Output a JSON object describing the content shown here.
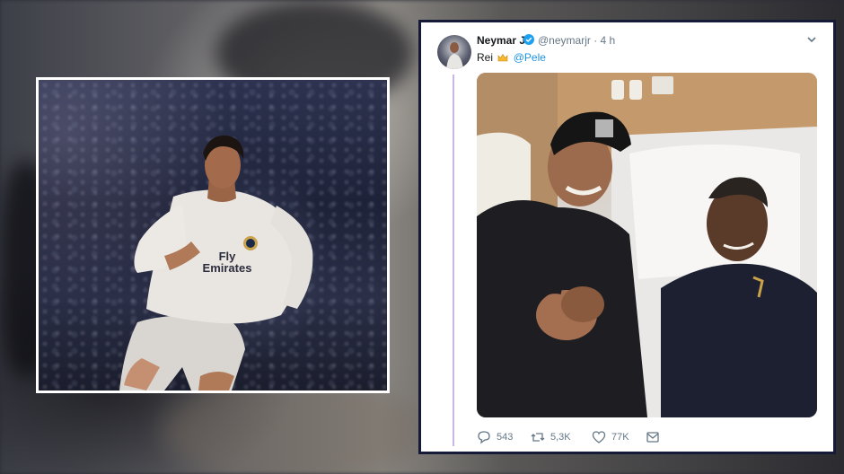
{
  "tweet": {
    "author_name": "Neymar Jr",
    "handle_time": "@neymarjr · 4 h",
    "text_before": "Rei",
    "mention": "@Pele",
    "reply_count": "543",
    "retweet_count": "5,3K",
    "like_count": "77K"
  },
  "jersey": {
    "sponsor_line1": "Fly",
    "sponsor_line2": "Emirates"
  },
  "icons": [
    "verified-badge-icon",
    "chevron-down-icon",
    "crown-emoji-icon",
    "reply-icon",
    "retweet-icon",
    "like-icon",
    "direct-message-icon"
  ],
  "colors": {
    "tweet_border": "#141a38",
    "mention": "#1b95e0",
    "thread_line": "#c8b6e6",
    "muted_text": "#657786"
  }
}
